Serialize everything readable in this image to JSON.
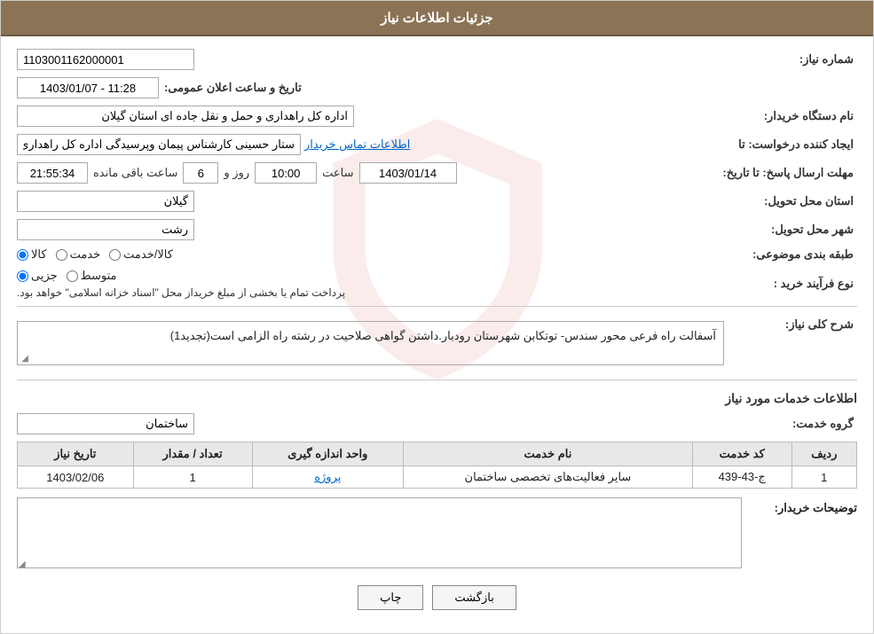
{
  "header": {
    "title": "جزئیات اطلاعات نیاز"
  },
  "fields": {
    "need_number_label": "شماره نیاز:",
    "need_number_value": "1103001162000001",
    "buyer_org_label": "نام دستگاه خریدار:",
    "buyer_org_value": "اداره کل راهداری و حمل و نقل جاده ای استان گیلان",
    "creator_label": "ایجاد کننده درخواست: تا",
    "creator_value": "ستار حسینی کارشناس پیمان وپرسیدگی اداره کل راهداری و حمل و نقل جاده اد",
    "creator_link": "اطلاعات تماس خریدار",
    "response_deadline_label": "مهلت ارسال پاسخ: تا تاریخ:",
    "deadline_date": "1403/01/14",
    "deadline_time_label": "ساعت",
    "deadline_time": "10:00",
    "days_label": "روز و",
    "days_value": "6",
    "remaining_label": "ساعت باقی مانده",
    "remaining_time": "21:55:34",
    "province_label": "استان محل تحویل:",
    "province_value": "گیلان",
    "city_label": "شهر محل تحویل:",
    "city_value": "رشت",
    "category_label": "طبقه بندی موضوعی:",
    "cat_r1": "کالا",
    "cat_r2": "خدمت",
    "cat_r3": "کالا/خدمت",
    "process_label": "نوع فرآیند خرید :",
    "proc_r1": "جزیی",
    "proc_r2": "متوسط",
    "proc_detail": "پرداخت تمام یا بخشی از مبلغ خریداز محل \"اسناد خزانه اسلامی\" خواهد بود.",
    "announce_label": "تاریخ و ساعت اعلان عمومی:",
    "announce_value": "1403/01/07 - 11:28",
    "need_desc_label": "شرح کلی نیاز:",
    "need_desc_value": "آسفالت راه فرعی محور سندس- توتکابن شهرستان رودبار.داشتن گواهی صلاحیت در رشته راه الزامی است(تجدید1)",
    "service_info_label": "اطلاعات خدمات مورد نیاز",
    "service_group_label": "گروه خدمت:",
    "service_group_value": "ساختمان",
    "table": {
      "headers": [
        "ردیف",
        "کد خدمت",
        "نام خدمت",
        "واحد اندازه گیری",
        "تعداد / مقدار",
        "تاریخ نیاز"
      ],
      "rows": [
        {
          "row": "1",
          "code": "ج-43-439",
          "name": "سایر فعالیت‌های تخصصی ساختمان",
          "unit": "پروژه",
          "qty": "1",
          "date": "1403/02/06"
        }
      ]
    },
    "buyer_desc_label": "توضیحات خریدار:",
    "buyer_desc_value": ""
  },
  "buttons": {
    "back_label": "بازگشت",
    "print_label": "چاپ"
  }
}
